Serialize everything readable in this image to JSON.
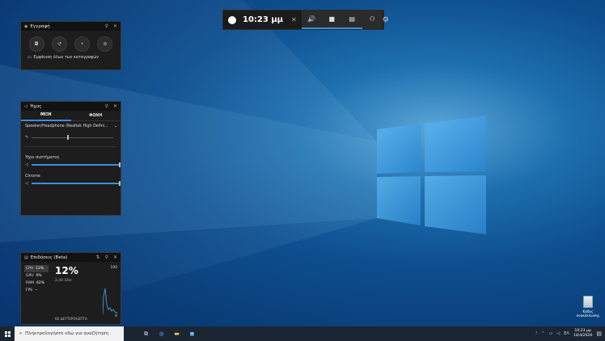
{
  "gamebar": {
    "time": "10:23 μμ",
    "buttons": [
      {
        "name": "audio-icon",
        "glyph": "🔊"
      },
      {
        "name": "capture-icon",
        "glyph": "▣"
      },
      {
        "name": "performance-icon",
        "glyph": "▤"
      },
      {
        "name": "xbox-social-icon",
        "glyph": "👥"
      }
    ]
  },
  "capture_widget": {
    "title": "Εγγραφή",
    "show_all_captures": "Εμφάνιση όλων των καταγραφών"
  },
  "audio_widget": {
    "title": "Ήχος",
    "tabs": [
      "ΜΙΞΗ",
      "ΦΩΝΗ"
    ],
    "device": "Speaker/Headphone (Realtek High Defini...",
    "device_level": 0.4,
    "mixer": [
      {
        "label": "Ήχοι συστήματος",
        "level": 1.0
      },
      {
        "label": "Chrome",
        "level": 1.0
      }
    ]
  },
  "performance_widget": {
    "title": "Επιδόσεις (Beta)",
    "metrics": [
      {
        "label": "CPU",
        "value": "12%"
      },
      {
        "label": "GPU",
        "value": "0%"
      },
      {
        "label": "RAM",
        "value": "62%"
      },
      {
        "label": "FPS",
        "value": "--"
      }
    ],
    "big_value": "12%",
    "frequency": "2,40 GHz",
    "axis_max": "100",
    "axis_min": "0",
    "range_label": "60 ΔΕΥΤΕΡΟΛΕΠΤΑ"
  },
  "desktop": {
    "recycle_bin": "Κάδος ανακύκλωσης"
  },
  "taskbar": {
    "search_placeholder": "Πληκτρολογήστε εδώ για αναζήτηση",
    "language": "ΕΛ",
    "time": "10:23 μμ",
    "date": "14/4/2020"
  }
}
